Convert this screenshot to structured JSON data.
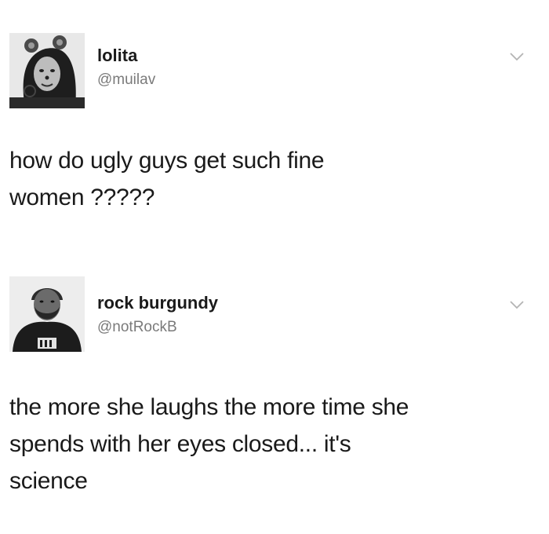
{
  "tweets": [
    {
      "display_name": "lolita",
      "handle": "@muilav",
      "avatar": "profile-photo-woman-with-bear-ears",
      "text_lines": [
        "how do ugly guys get such fine",
        "women ?????"
      ],
      "menu_icon": "chevron-down-icon"
    },
    {
      "display_name": "rock burgundy",
      "handle": "@notRockB",
      "avatar": "profile-photo-man-with-beard",
      "text_lines": [
        "the more she laughs the more time she",
        "spends with her eyes closed... it's",
        "science"
      ],
      "menu_icon": "chevron-down-icon"
    }
  ],
  "colors": {
    "background": "#ffffff",
    "text": "#1a1a1a",
    "handle": "#7a7a7a",
    "chevron": "#b4b4b4"
  }
}
